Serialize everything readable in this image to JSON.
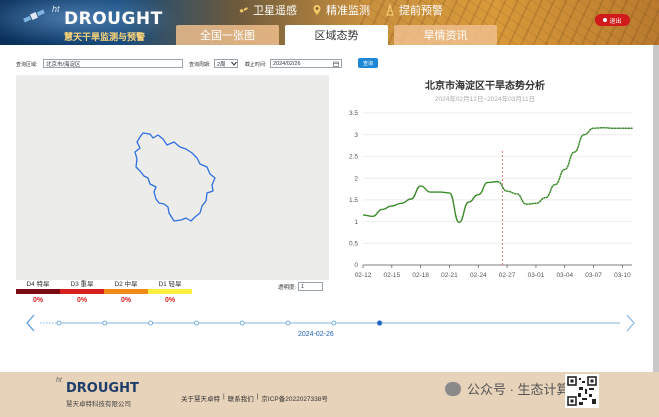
{
  "header": {
    "logo_ht": "ht",
    "logo_title": "DROUGHT",
    "logo_subtitle": "慧天干旱监测与预警",
    "topnav": [
      "卫星遥感",
      "精准监测",
      "提前预警"
    ],
    "tabs": [
      "全国一张图",
      "区域态势",
      "旱情资讯"
    ],
    "active_tab": 1,
    "logout_label": "退出"
  },
  "query": {
    "region_label": "查询区域:",
    "region_value": "北京市/海淀区",
    "period_label": "查询周期:",
    "period_value": "2周",
    "date_label": "截止时间:",
    "date_value": "2024/02/26",
    "submit_label": "查询"
  },
  "legend": [
    {
      "label": "D4 特旱",
      "percent": "0%",
      "color": "#7a0b12"
    },
    {
      "label": "D3 重旱",
      "percent": "0%",
      "color": "#d81f1f"
    },
    {
      "label": "D2 中旱",
      "percent": "0%",
      "color": "#f08a18"
    },
    {
      "label": "D1 轻旱",
      "percent": "0%",
      "color": "#ffee3b"
    }
  ],
  "opacity": {
    "label": "透明度:",
    "value": "1"
  },
  "chart": {
    "title": "北京市海淀区干旱态势分析",
    "subtitle": "2024年02月12日~2024年03月11日"
  },
  "chart_data": {
    "type": "line",
    "title": "北京市海淀区干旱态势分析",
    "subtitle": "2024年02月12日~2024年03月11日",
    "x_ticks": [
      "02-12",
      "02-15",
      "02-18",
      "02-21",
      "02-24",
      "02-27",
      "03-01",
      "03-04",
      "03-07",
      "03-10"
    ],
    "ylim": [
      0,
      3.5
    ],
    "y_ticks": [
      "0",
      "0.5",
      "1",
      "1.5",
      "2",
      "2.5",
      "3",
      "3.5"
    ],
    "marker_day": 14.5,
    "series": [
      {
        "style": "solid",
        "color": "#3b8b2a",
        "points": [
          [
            0,
            1.15
          ],
          [
            1,
            1.12
          ],
          [
            2,
            1.28
          ],
          [
            3,
            1.36
          ],
          [
            4,
            1.42
          ],
          [
            5,
            1.52
          ],
          [
            6,
            1.82
          ],
          [
            7,
            1.68
          ],
          [
            8,
            1.68
          ],
          [
            9,
            1.66
          ],
          [
            10,
            0.98
          ],
          [
            11,
            1.45
          ],
          [
            12,
            1.62
          ],
          [
            13,
            1.9
          ],
          [
            14,
            1.92
          ]
        ]
      },
      {
        "style": "dotted",
        "color": "#3b8b2a",
        "points": [
          [
            14,
            1.92
          ],
          [
            15,
            1.7
          ],
          [
            16,
            1.64
          ],
          [
            17,
            1.4
          ],
          [
            18,
            1.42
          ],
          [
            19,
            1.55
          ],
          [
            20,
            1.85
          ],
          [
            21,
            2.2
          ],
          [
            22,
            2.6
          ],
          [
            23,
            3.0
          ],
          [
            24,
            3.15
          ],
          [
            25,
            3.16
          ],
          [
            26,
            3.15
          ],
          [
            27,
            3.15
          ],
          [
            28,
            3.15
          ]
        ]
      }
    ]
  },
  "timeline": {
    "current_date": "2024-02-26",
    "node_count": 8,
    "current_index": 7
  },
  "footer": {
    "logo_ht": "ht",
    "logo_title": "DROUGHT",
    "company": "慧天卓特科技有限公司",
    "links": [
      "关于慧天卓特",
      "|",
      "联系我们",
      "|",
      "京ICP备2022027338号"
    ],
    "watermark": "公众号 · 生态计算"
  }
}
